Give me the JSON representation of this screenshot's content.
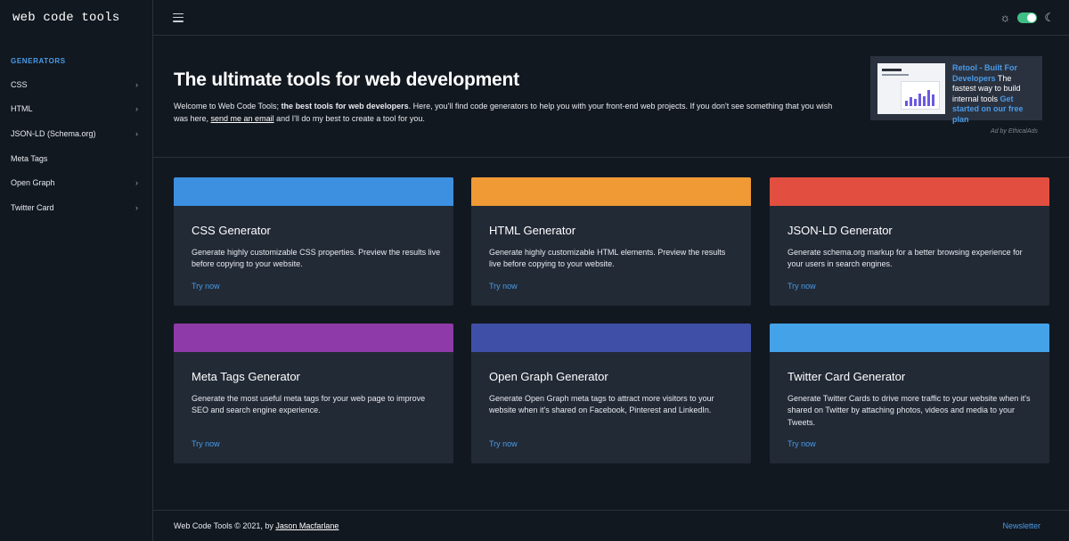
{
  "brand": {
    "logo_text": "web code tools"
  },
  "sidebar": {
    "heading": "GENERATORS",
    "items": [
      {
        "label": "CSS",
        "has_children": true
      },
      {
        "label": "HTML",
        "has_children": true
      },
      {
        "label": "JSON-LD (Schema.org)",
        "has_children": true
      },
      {
        "label": "Meta Tags",
        "has_children": false
      },
      {
        "label": "Open Graph",
        "has_children": true
      },
      {
        "label": "Twitter Card",
        "has_children": true
      }
    ]
  },
  "topbar": {
    "menu_icon": "hamburger-icon",
    "light_icon": "sun-icon",
    "dark_icon": "moon-icon",
    "toggle_color": "#3fbf85"
  },
  "hero": {
    "title": "The ultimate tools for web development",
    "intro_1": "Welcome to Web Code Tools; ",
    "intro_bold": "the best tools for web developers",
    "intro_2": ". Here, you'll find code generators to help you with your front-end web projects. If you don't see something that you wish was here, ",
    "email_link": "send me an email",
    "intro_3": " and I'll do my best to create a tool for you."
  },
  "ad": {
    "headline": "Retool - Built For Developers",
    "body": " The fastest way to build internal tools ",
    "cta": "Get started on our free plan",
    "credit": "Ad by EthicalAds"
  },
  "cards": [
    {
      "title": "CSS Generator",
      "description": "Generate highly customizable CSS properties. Preview the results live before copying to your website.",
      "cta": "Try now",
      "color": "#3d8fe0"
    },
    {
      "title": "HTML Generator",
      "description": "Generate highly customizable HTML elements. Preview the results live before copying to your website.",
      "cta": "Try now",
      "color": "#ef9a35"
    },
    {
      "title": "JSON-LD Generator",
      "description": "Generate schema.org markup for a better browsing experience for your users in search engines.",
      "cta": "Try now",
      "color": "#e24f40"
    },
    {
      "title": "Meta Tags Generator",
      "description": "Generate the most useful meta tags for your web page to improve SEO and search engine experience.",
      "cta": "Try now",
      "color": "#8e3aa8"
    },
    {
      "title": "Open Graph Generator",
      "description": "Generate Open Graph meta tags to attract more visitors to your website when it's shared on Facebook, Pinterest and LinkedIn.",
      "cta": "Try now",
      "color": "#3f4fa8"
    },
    {
      "title": "Twitter Card Generator",
      "description": "Generate Twitter Cards to drive more traffic to your website when it's shared on Twitter by attaching photos, videos and media to your Tweets.",
      "cta": "Try now",
      "color": "#44a2e8"
    }
  ],
  "footer": {
    "copyright": "Web Code Tools © 2021, by ",
    "author": "Jason Macfarlane",
    "newsletter": "Newsletter"
  }
}
